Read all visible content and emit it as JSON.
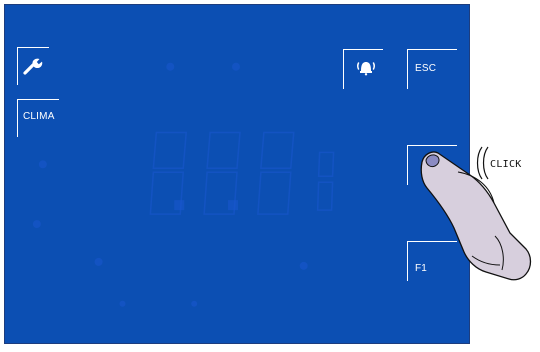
{
  "screen": {
    "background_color": "#0c4fb3",
    "ghost_segment_color": "#1b5ad1",
    "button_line_color": "#ffffff"
  },
  "buttons": {
    "settings": {
      "icon": "wrench-icon"
    },
    "clima": {
      "label": "CLIMA"
    },
    "alarm": {
      "icon": "bell-icon"
    },
    "esc": {
      "label": "ESC"
    },
    "blank": {
      "label": ""
    },
    "f1": {
      "label": "F1"
    }
  },
  "display": {
    "segment_value": "",
    "ghost_digits": 3
  },
  "annotation": {
    "click_text": "CLICK",
    "pointer": "finger-pointer"
  }
}
